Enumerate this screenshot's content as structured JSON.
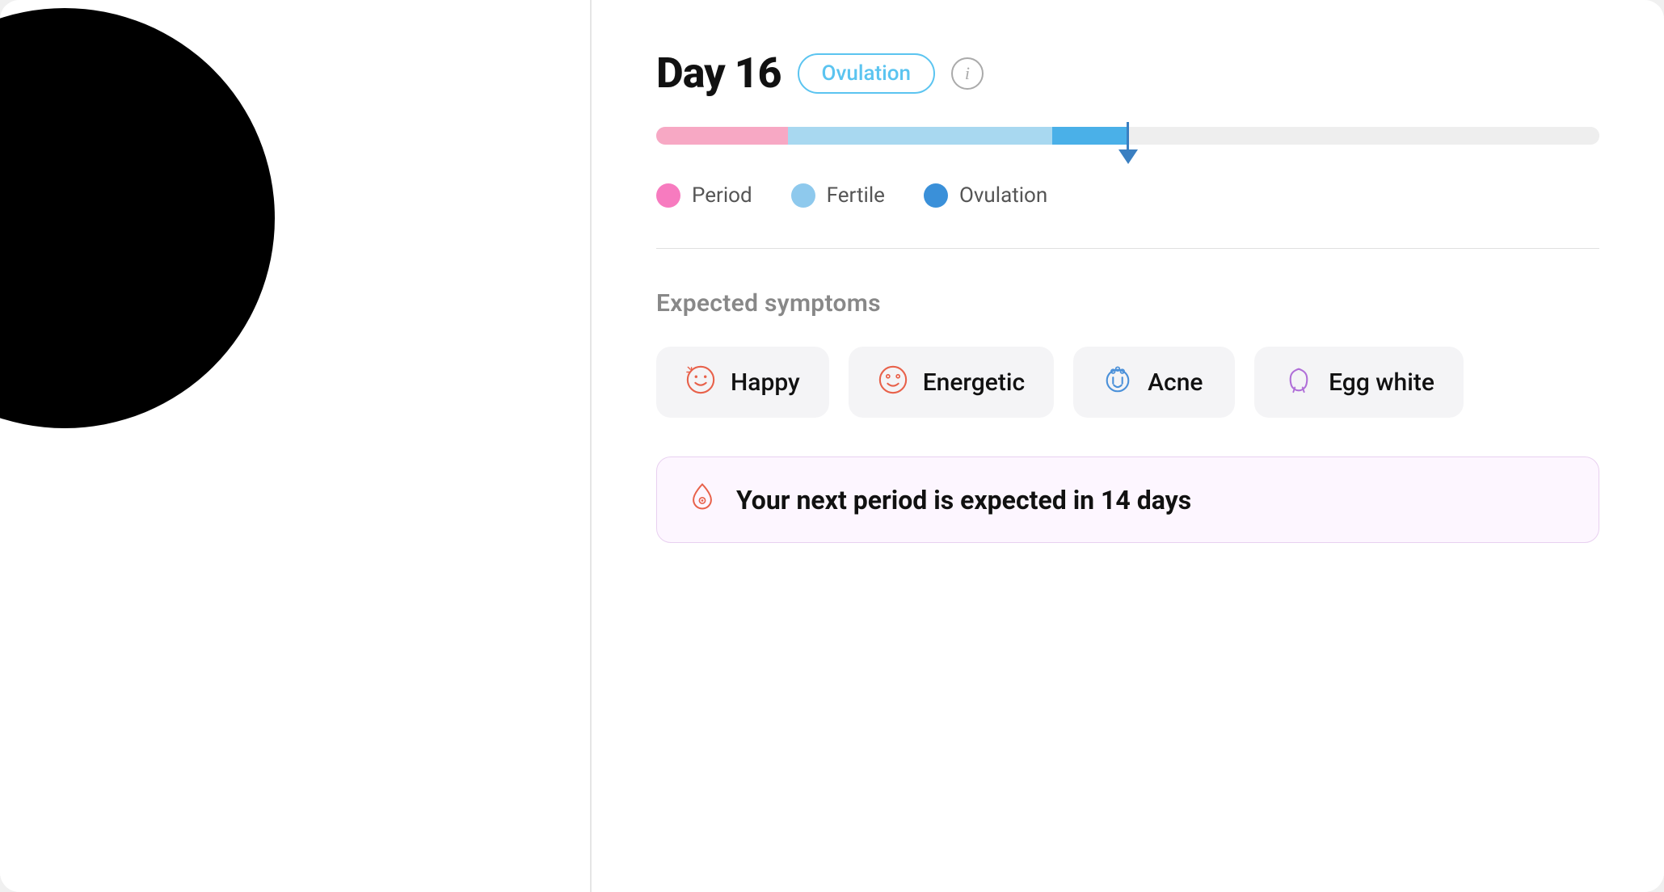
{
  "header": {
    "day_label": "Day 16",
    "phase_label": "Ovulation",
    "info_icon": "i"
  },
  "progress_bar": {
    "marker_position": "50%"
  },
  "legend": [
    {
      "id": "period",
      "label": "Period",
      "color": "#f77bbf"
    },
    {
      "id": "fertile",
      "label": "Fertile",
      "color": "#8ec9ed"
    },
    {
      "id": "ovulation",
      "label": "Ovulation",
      "color": "#3a90d9"
    }
  ],
  "sections": {
    "symptoms_title": "Expected symptoms",
    "symptoms": [
      {
        "id": "happy",
        "label": "Happy",
        "icon_type": "happy"
      },
      {
        "id": "energetic",
        "label": "Energetic",
        "icon_type": "energetic"
      },
      {
        "id": "acne",
        "label": "Acne",
        "icon_type": "acne"
      },
      {
        "id": "egg_white",
        "label": "Egg white",
        "icon_type": "egg_white"
      }
    ],
    "notification": {
      "text": "Your next period is expected in 14 days",
      "icon_type": "drop"
    }
  }
}
